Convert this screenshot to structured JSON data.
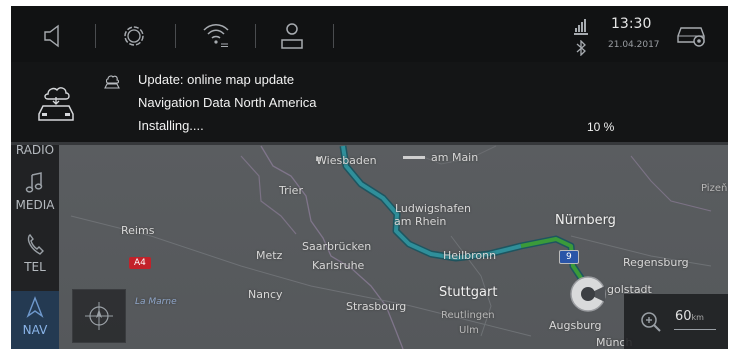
{
  "status": {
    "time": "13:30",
    "date": "21.04.2017"
  },
  "notification": {
    "title": "Update: online map update",
    "subtitle": "Navigation Data North America",
    "status": "Installing....",
    "progress": "10 %"
  },
  "sidebar": {
    "items": [
      {
        "label": "RADIO"
      },
      {
        "label": "MEDIA"
      },
      {
        "label": "TEL"
      },
      {
        "label": "NAV"
      }
    ]
  },
  "map": {
    "cities": [
      "Wiesbaden",
      "am Main",
      "Trier",
      "Ludwigshafen",
      "am Rhein",
      "Nürnberg",
      "Reims",
      "Metz",
      "Saarbrücken",
      "Karlsruhe",
      "Heilbronn",
      "Regensburg",
      "Nancy",
      "Strasbourg",
      "Stuttgart",
      "Reutlingen",
      "Ulm",
      "Augsburg",
      "Pizeň",
      "golstadt",
      "Münch",
      "La Marne"
    ],
    "road_badges": [
      "A4",
      "9"
    ],
    "scale": {
      "value": "60",
      "unit": "km"
    }
  },
  "colors": {
    "route": "#2f8f9a",
    "route_alt": "#3a9a3a",
    "accent": "#8ab4e8",
    "background": "#111213"
  }
}
